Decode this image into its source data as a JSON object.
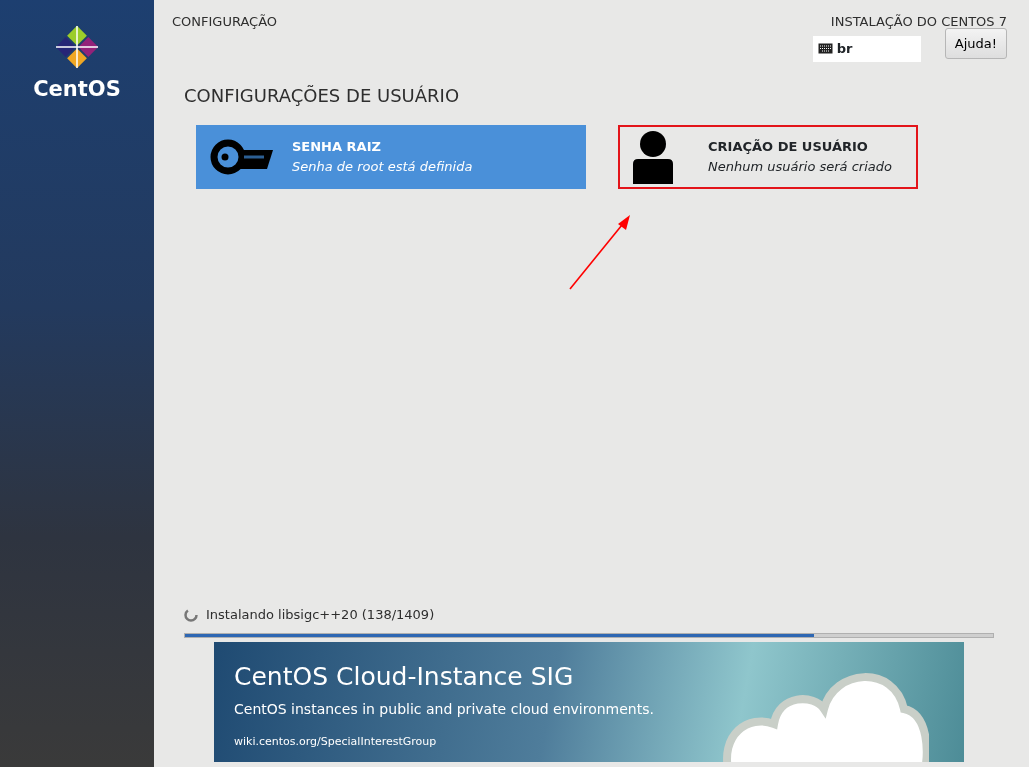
{
  "sidebar": {
    "logo_text": "CentOS"
  },
  "header": {
    "title": "CONFIGURAÇÃO",
    "product": "INSTALAÇÃO DO CENTOS 7",
    "keyboard_layout": "br",
    "help_button": "Ajuda!"
  },
  "section": {
    "title": "CONFIGURAÇÕES DE USUÁRIO"
  },
  "spokes": [
    {
      "kind": "key",
      "title": "SENHA RAIZ",
      "status": "Senha de root está definida",
      "selected": true,
      "highlighted": false
    },
    {
      "kind": "user",
      "title": "CRIAÇÃO DE USUÁRIO",
      "status": "Nenhum usuário será criado",
      "selected": false,
      "highlighted": true
    }
  ],
  "progress": {
    "status": "Instalando libsigc++20 (138/1409)",
    "level": 0.778
  },
  "banner": {
    "title": "CentOS Cloud-Instance SIG",
    "subtitle": "CentOS instances in public and private cloud environments.",
    "link": "wiki.centos.org/SpecialInterestGroup"
  }
}
